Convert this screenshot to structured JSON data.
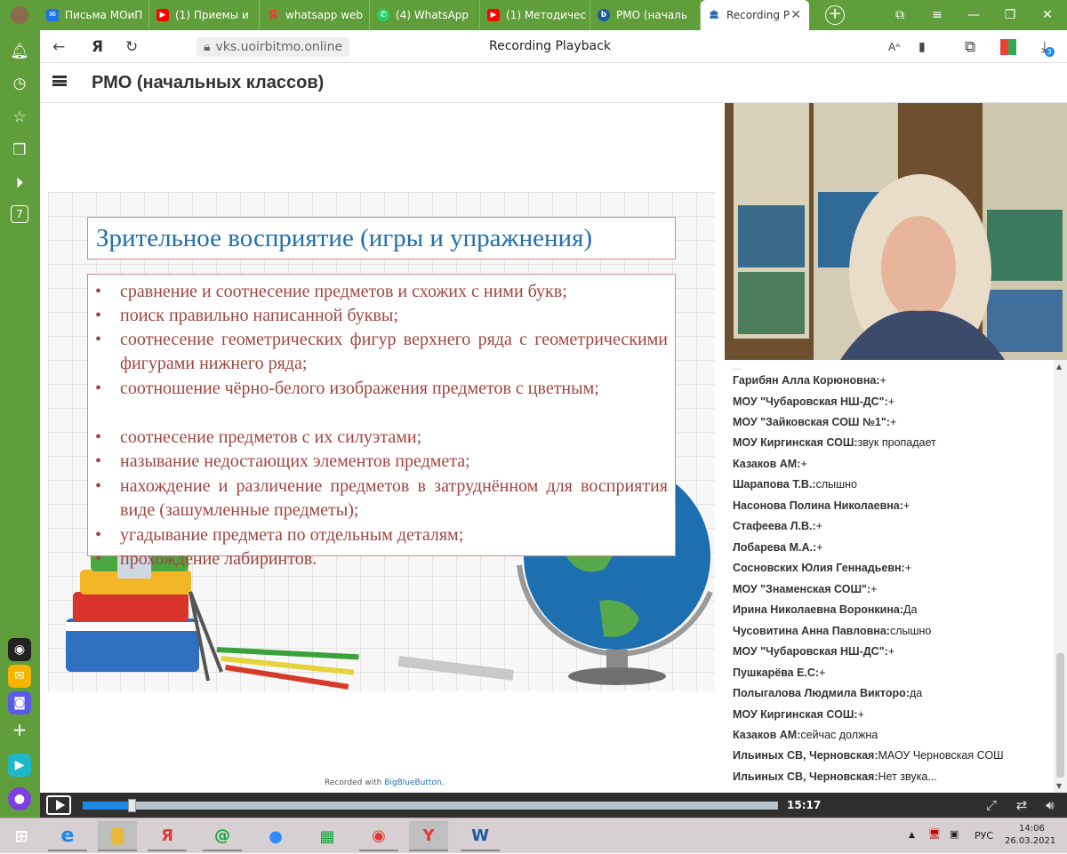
{
  "browser": {
    "tabs": [
      {
        "label": "Письма МОиП",
        "icon": "mail-icon",
        "color": "#1a73e8"
      },
      {
        "label": "(1) Приемы и",
        "icon": "youtube-icon",
        "color": "#ff0000"
      },
      {
        "label": "whatsapp web",
        "icon": "yandex-icon",
        "color": "#ff3333"
      },
      {
        "label": "(4) WhatsApp",
        "icon": "whatsapp-icon",
        "color": "#25d366"
      },
      {
        "label": "(1) Методичес",
        "icon": "youtube-icon",
        "color": "#ff0000"
      },
      {
        "label": "РМО (началь",
        "icon": "bbb-icon",
        "color": "#1e5aa0"
      },
      {
        "label": "Recording P",
        "icon": "museum-icon",
        "color": "#1a5fb4",
        "active": true
      }
    ],
    "address": {
      "url": "vks.uoirbitmo.online",
      "page_title": "Recording Playback",
      "badge_count": "3"
    }
  },
  "sidebar": {
    "apps": [
      "bell",
      "history",
      "star",
      "collections",
      "play",
      "calendar-7"
    ],
    "calendar_label": "7"
  },
  "bbb": {
    "room_title": "РМО (начальных классов)",
    "slide": {
      "title": "Зрительное восприятие (игры и упражнения)",
      "bullets": [
        "сравнение и соотнесение предметов и схожих с ними букв;",
        "поиск правильно написанной буквы;",
        "соотнесение геометрических фигур верхнего ряда с геометрическими фигурами нижнего ряда;",
        "соотношение чёрно-белого изображения предметов с цветным;",
        "соотнесение предметов с их силуэтами;",
        "называние недостающих элементов предмета;",
        "нахождение и различение предметов в затруднённом для восприятия виде (зашумленные предметы);",
        "угадывание предмета по отдельным деталям;",
        "прохождение лабиринтов."
      ]
    },
    "recorded_with": "Recorded with",
    "recorded_brand": "BigBlueButton.",
    "chat": [
      {
        "name": "Гарибян Алла Корюновна:",
        "text": "+"
      },
      {
        "name": "МОУ \"Чубаровская НШ-ДС\":",
        "text": "+"
      },
      {
        "name": "МОУ \"Зайковская СОШ №1\":",
        "text": "+"
      },
      {
        "name": "МОУ Киргинская СОШ:",
        "text": "звук пропадает"
      },
      {
        "name": "Казаков АМ:",
        "text": "+"
      },
      {
        "name": "Шарапова Т.В.:",
        "text": "слышно"
      },
      {
        "name": "Насонова Полина Николаевна:",
        "text": "+"
      },
      {
        "name": "Стафеева Л.В.:",
        "text": "+"
      },
      {
        "name": "Лобарева М.А.:",
        "text": "+"
      },
      {
        "name": "Сосновских Юлия Геннадьевн:",
        "text": "+"
      },
      {
        "name": "МОУ \"Знаменская СОШ\":",
        "text": "+"
      },
      {
        "name": "Ирина Николаевна Воронкина:",
        "text": "Да"
      },
      {
        "name": "Чусовитина Анна Павловна:",
        "text": "слышно"
      },
      {
        "name": "МОУ \"Чубаровская НШ-ДС\":",
        "text": "+"
      },
      {
        "name": "Пушкарёва Е.С:",
        "text": "+"
      },
      {
        "name": "Полыгалова Людмила Викторо:",
        "text": "да"
      },
      {
        "name": "МОУ Киргинская СОШ:",
        "text": "+"
      },
      {
        "name": "Казаков АМ:",
        "text": "сейчас должна"
      },
      {
        "name": "Ильиных СВ, Черновская:",
        "text": "МАОУ Черновская СОШ"
      },
      {
        "name": "Ильиных СВ, Черновская:",
        "text": "Нет звука..."
      }
    ],
    "player": {
      "time": "15:17",
      "progress": 0.07
    }
  },
  "taskbar": {
    "apps": [
      "start",
      "ie",
      "explorer",
      "yandex-browser",
      "mail-ru",
      "zoom",
      "store",
      "chrome",
      "yandex",
      "word"
    ],
    "tray": {
      "lang": "РУС",
      "time": "14:06",
      "date": "26.03.2021"
    }
  }
}
